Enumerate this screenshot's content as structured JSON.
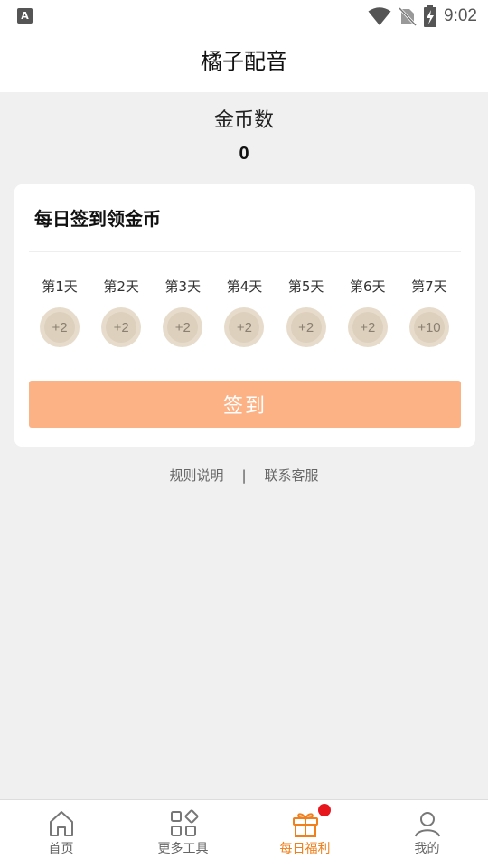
{
  "status_bar": {
    "time": "9:02",
    "notification_icon": "A"
  },
  "header": {
    "title": "橘子配音"
  },
  "coins": {
    "label": "金币数",
    "count": "0"
  },
  "signin_card": {
    "title": "每日签到领金币",
    "days": [
      {
        "label": "第1天",
        "reward": "+2"
      },
      {
        "label": "第2天",
        "reward": "+2"
      },
      {
        "label": "第3天",
        "reward": "+2"
      },
      {
        "label": "第4天",
        "reward": "+2"
      },
      {
        "label": "第5天",
        "reward": "+2"
      },
      {
        "label": "第6天",
        "reward": "+2"
      },
      {
        "label": "第7天",
        "reward": "+10"
      }
    ],
    "button_label": "签到"
  },
  "links": {
    "rules": "规则说明",
    "separator": "|",
    "contact": "联系客服"
  },
  "tabs": [
    {
      "label": "首页",
      "icon": "home-icon"
    },
    {
      "label": "更多工具",
      "icon": "grid-icon"
    },
    {
      "label": "每日福利",
      "icon": "gift-icon",
      "active": true
    },
    {
      "label": "我的",
      "icon": "user-icon"
    }
  ],
  "colors": {
    "accent": "#f07f1c",
    "button": "#fdb285",
    "badge": "#e6161c",
    "coin": "#e7dccb"
  }
}
